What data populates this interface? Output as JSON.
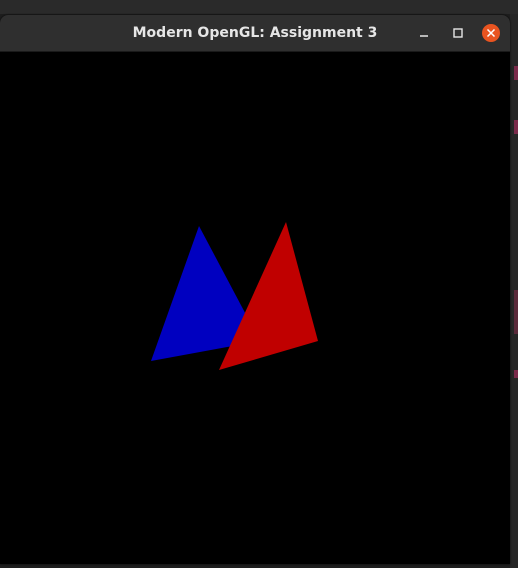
{
  "window": {
    "title": "Modern OpenGL: Assignment 3",
    "controls": {
      "minimize": "minimize-icon",
      "maximize": "maximize-icon",
      "close": "close-icon"
    },
    "close_color": "#e95420",
    "titlebar_color": "#2f2f2f"
  },
  "scene": {
    "background": "#000000",
    "triangles": [
      {
        "name": "blue-triangle",
        "color": "#0000c0"
      },
      {
        "name": "red-triangle",
        "color": "#c00000"
      }
    ]
  }
}
